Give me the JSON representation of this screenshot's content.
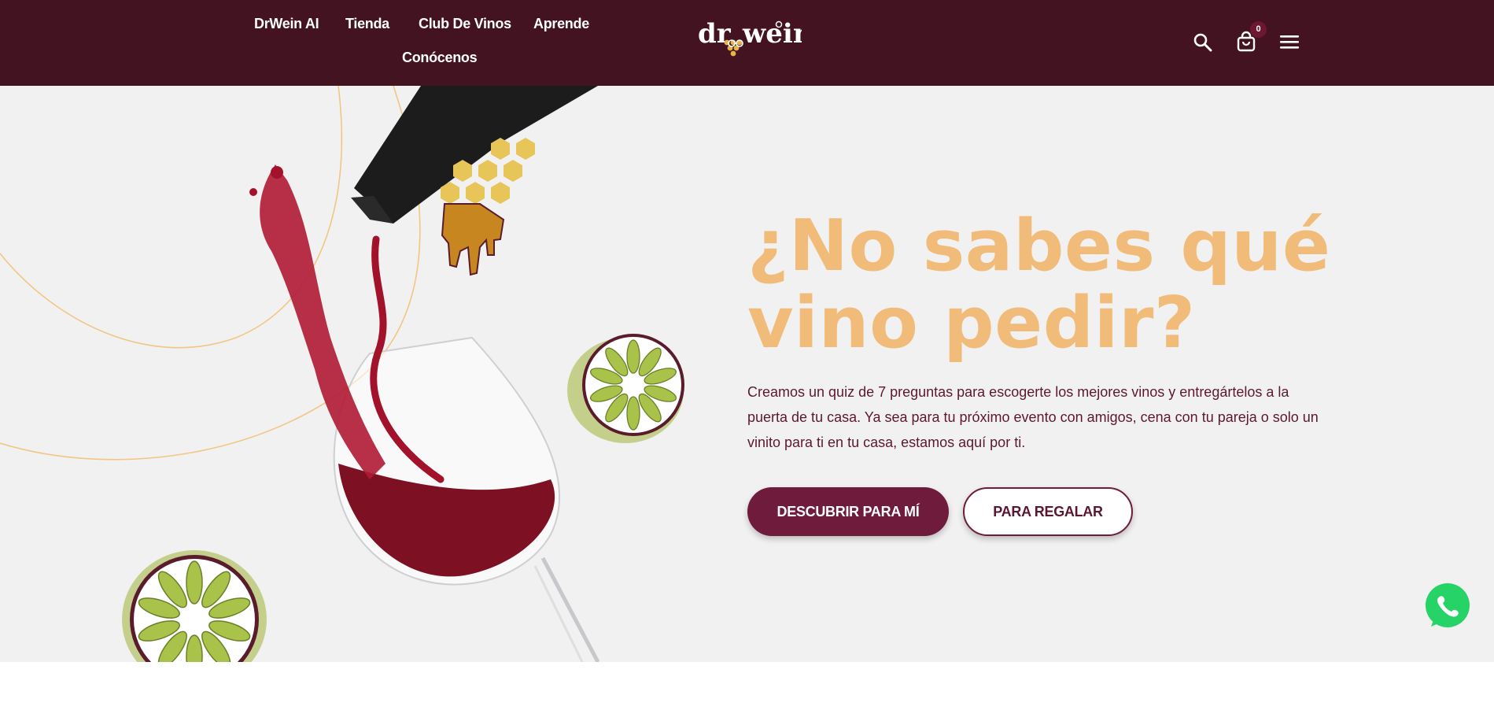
{
  "header": {
    "nav": [
      {
        "label": "DrWein AI"
      },
      {
        "label": "Tienda"
      },
      {
        "label": "Club De Vinos"
      },
      {
        "label": "Aprende"
      },
      {
        "label": "Conócenos"
      }
    ],
    "logo_text": "dr.wein",
    "cart_count": "0",
    "icons": [
      "search-icon",
      "cart-icon",
      "menu-icon"
    ]
  },
  "hero": {
    "headline": "¿No sabes qué vino pedir?",
    "description": "Creamos un quiz de 7 preguntas para escogerte los mejores vinos y entregártelos a la puerta de tu casa. Ya sea para tu próximo evento con amigos, cena con tu pareja o solo un vinito para ti en tu casa, estamos aquí por ti.",
    "primary_button": "DESCUBRIR PARA MÍ",
    "secondary_button": "PARA REGALAR"
  },
  "colors": {
    "header_bg": "#441321",
    "hero_bg": "#f2f1f1",
    "headline": "#f1bc79",
    "text": "#5c1830",
    "primary_button": "#6e1b3c",
    "whatsapp": "#25d366"
  },
  "floating": {
    "whatsapp_icon": "whatsapp-icon"
  }
}
